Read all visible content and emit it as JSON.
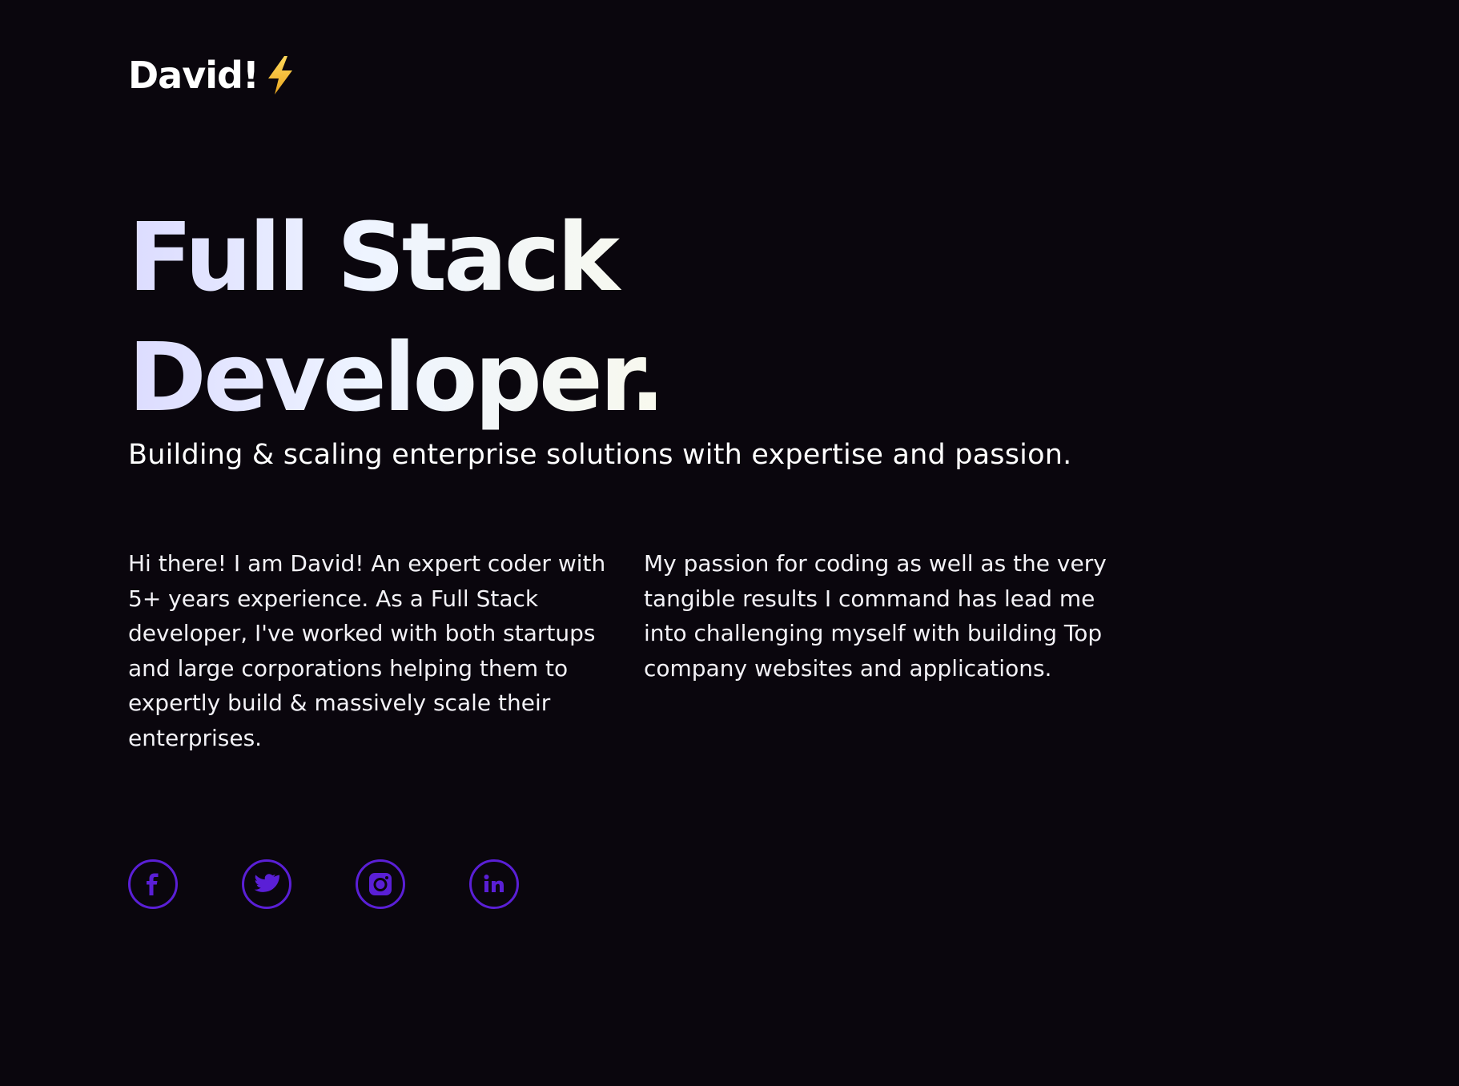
{
  "brand": {
    "name": "David!",
    "logo_icon": "lightning-bolt-icon"
  },
  "hero": {
    "line1": "Full Stack",
    "line2": "Developer.",
    "subtitle": "Building & scaling enterprise solutions with expertise and passion."
  },
  "bio": {
    "left": "Hi there! I am David! An expert coder with 5+ years experience. As a Full Stack developer, I've worked with both startups and large corporations helping them to expertly build & massively scale their enterprises.",
    "right": "My passion for coding as well as the very tangible results I command has lead me into challenging myself with building Top company websites and applications."
  },
  "socials": [
    {
      "icon": "facebook-icon"
    },
    {
      "icon": "twitter-icon"
    },
    {
      "icon": "instagram-icon"
    },
    {
      "icon": "linkedin-icon"
    }
  ],
  "colors": {
    "background": "#0a060d",
    "accent": "#5a1fd6",
    "text": "#ffffff",
    "bolt": "#f5c842"
  }
}
